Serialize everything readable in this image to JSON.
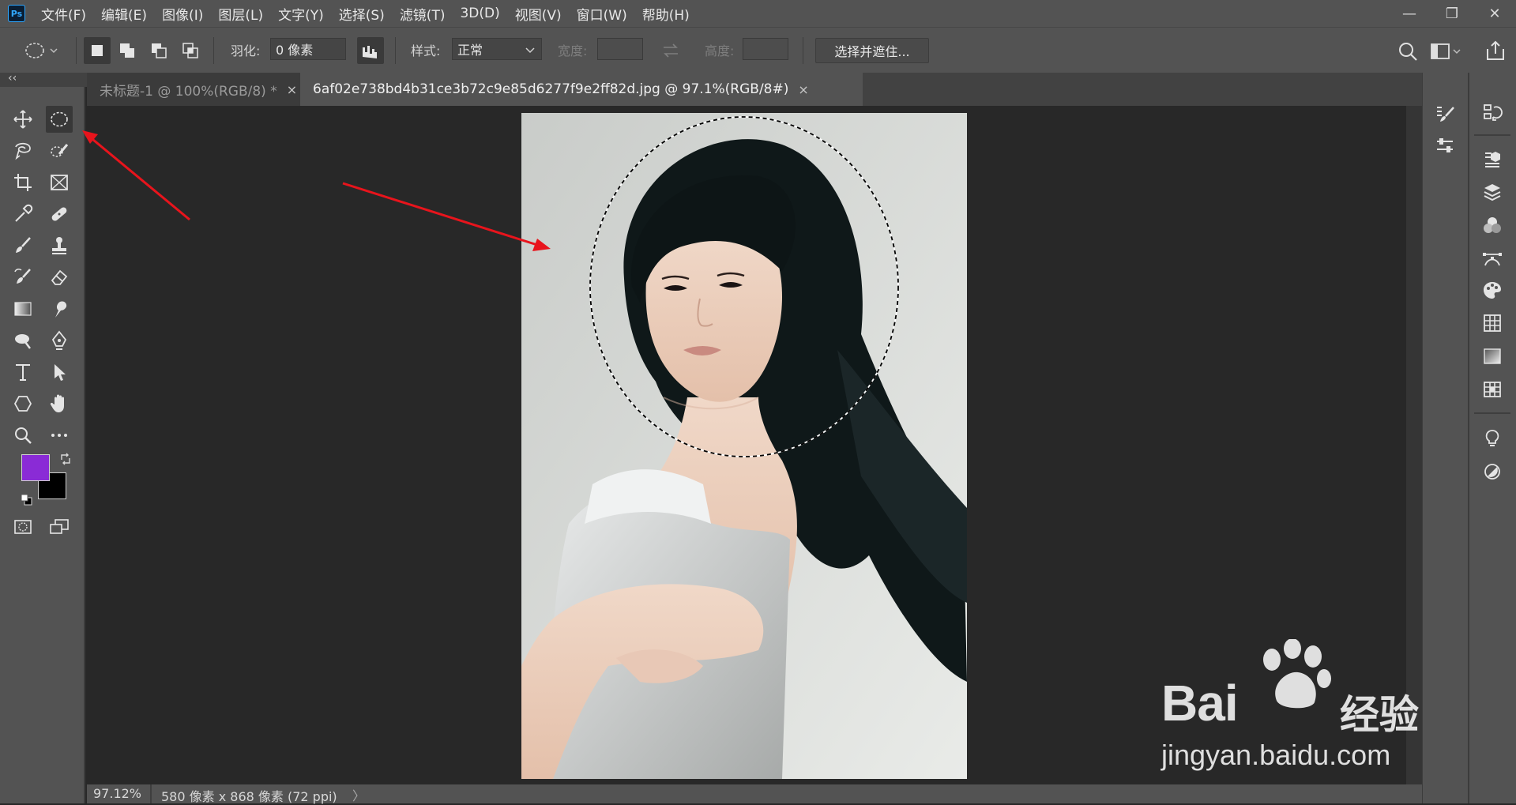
{
  "app": {
    "logo_text": "Ps"
  },
  "menu": [
    "文件(F)",
    "编辑(E)",
    "图像(I)",
    "图层(L)",
    "文字(Y)",
    "选择(S)",
    "滤镜(T)",
    "3D(D)",
    "视图(V)",
    "窗口(W)",
    "帮助(H)"
  ],
  "window_controls": {
    "minimize": "—",
    "restore": "❐",
    "close": "✕"
  },
  "options": {
    "feather_label": "羽化:",
    "feather_value": "0 像素",
    "style_label": "样式:",
    "style_value": "正常",
    "width_label": "宽度:",
    "height_label": "高度:",
    "select_mask_label": "选择并遮住..."
  },
  "tabs": [
    {
      "label": "未标题-1 @ 100%(RGB/8) *",
      "close": "×"
    },
    {
      "label": "6af02e738bd4b31ce3b72c9e85d6277f9e2ff82d.jpg @ 97.1%(RGB/8#)",
      "close": "×"
    }
  ],
  "status": {
    "zoom": "97.12%",
    "doc_info": "580 像素 x 868 像素 (72 ppi)",
    "arrow": "〉"
  },
  "toolbar": {
    "collapse": "‹‹"
  },
  "colors": {
    "foreground": "#8a2bd6",
    "background": "#000000",
    "annotation_arrow": "#e8141c"
  },
  "watermark": {
    "brand": "Bai",
    "brand_suffix": "经验",
    "url": "jingyan.baidu.com"
  }
}
